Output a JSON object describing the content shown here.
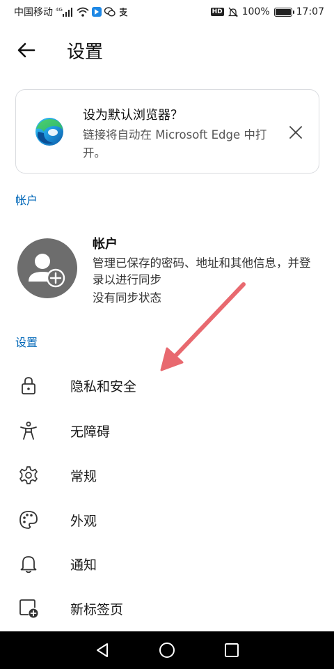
{
  "status_bar": {
    "carrier": "中国移动",
    "network": "4G",
    "battery_percent": "100%",
    "battery_level": 1.0,
    "time": "17:07",
    "hd_label": "HD"
  },
  "header": {
    "title": "设置",
    "back_icon": "arrow-left-icon"
  },
  "default_browser_card": {
    "title": "设为默认浏览器？",
    "body": "链接将自动在 Microsoft Edge 中打开。",
    "close_icon": "close-icon"
  },
  "account_section": {
    "header": "帐户",
    "title": "帐户",
    "description": "管理已保存的密码、地址和其他信息，并登录以进行同步",
    "sync_status": "没有同步状态",
    "avatar_icon": "add-user-icon"
  },
  "settings_section": {
    "header": "设置",
    "items": [
      {
        "label": "隐私和安全",
        "icon": "lock-icon"
      },
      {
        "label": "无障碍",
        "icon": "accessibility-icon"
      },
      {
        "label": "常规",
        "icon": "gear-icon"
      },
      {
        "label": "外观",
        "icon": "palette-icon"
      },
      {
        "label": "通知",
        "icon": "bell-icon"
      },
      {
        "label": "新标签页",
        "icon": "new-tab-icon"
      }
    ]
  },
  "colors": {
    "accent": "#0067b8",
    "annotation_arrow": "#e8696f",
    "nav_bar": "#000000"
  }
}
